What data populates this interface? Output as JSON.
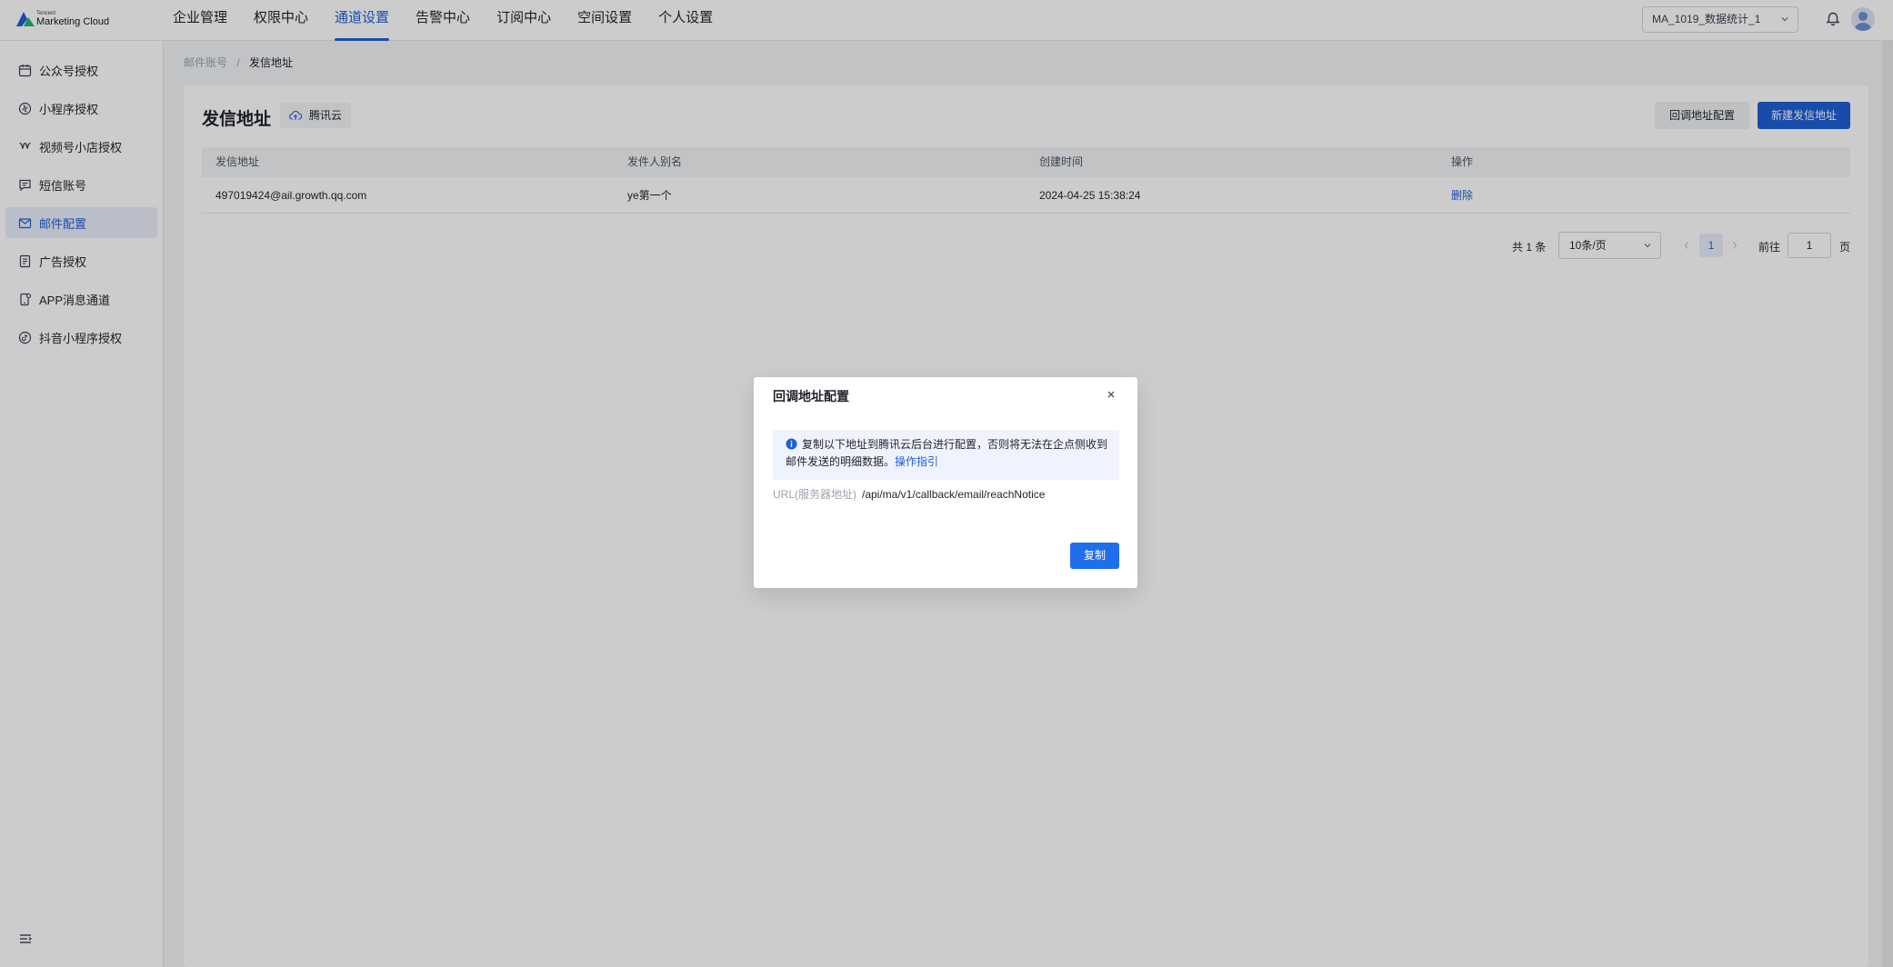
{
  "brand": {
    "small": "Tencent",
    "name": "Marketing Cloud",
    "colors": {
      "blue": "#1f5fd6",
      "green": "#22b46e"
    }
  },
  "top_nav": [
    {
      "label": "企业管理"
    },
    {
      "label": "权限中心"
    },
    {
      "label": "通道设置",
      "active": true
    },
    {
      "label": "告警中心"
    },
    {
      "label": "订阅中心"
    },
    {
      "label": "空间设置"
    },
    {
      "label": "个人设置"
    }
  ],
  "header": {
    "space_select": "MA_1019_数据统计_1"
  },
  "sidebar": {
    "items": [
      {
        "label": "公众号授权",
        "icon": "calendar-icon"
      },
      {
        "label": "小程序授权",
        "icon": "miniprogram-icon"
      },
      {
        "label": "视频号小店授权",
        "icon": "channels-icon"
      },
      {
        "label": "短信账号",
        "icon": "sms-icon"
      },
      {
        "label": "邮件配置",
        "icon": "mail-icon",
        "active": true
      },
      {
        "label": "广告授权",
        "icon": "ad-doc-icon"
      },
      {
        "label": "APP消息通道",
        "icon": "app-message-icon"
      },
      {
        "label": "抖音小程序授权",
        "icon": "douyin-icon"
      }
    ]
  },
  "breadcrumb": {
    "parent": "邮件账号",
    "separator": "/",
    "current": "发信地址"
  },
  "page": {
    "title": "发信地址",
    "provider": "腾讯云",
    "callback_button": "回调地址配置",
    "new_button": "新建发信地址"
  },
  "table": {
    "headers": [
      "发信地址",
      "发件人别名",
      "创建时间",
      "操作"
    ],
    "rows": [
      {
        "address": "497019424@ail.growth.qq.com",
        "alias": "ye第一个",
        "created": "2024-04-25 15:38:24",
        "action": "删除"
      }
    ]
  },
  "pagination": {
    "total": "共 1 条",
    "page_size": "10条/页",
    "current_page": "1",
    "goto_label": "前往",
    "goto_value": "1",
    "page_unit": "页"
  },
  "dialog": {
    "title": "回调地址配置",
    "alert_text": "复制以下地址到腾讯云后台进行配置，否则将无法在企点侧收到邮件发送的明细数据。",
    "alert_link": "操作指引",
    "url_label": "URL(服务器地址)",
    "url_value": "/api/ma/v1/callback/email/reachNotice",
    "copy_button": "复制"
  }
}
